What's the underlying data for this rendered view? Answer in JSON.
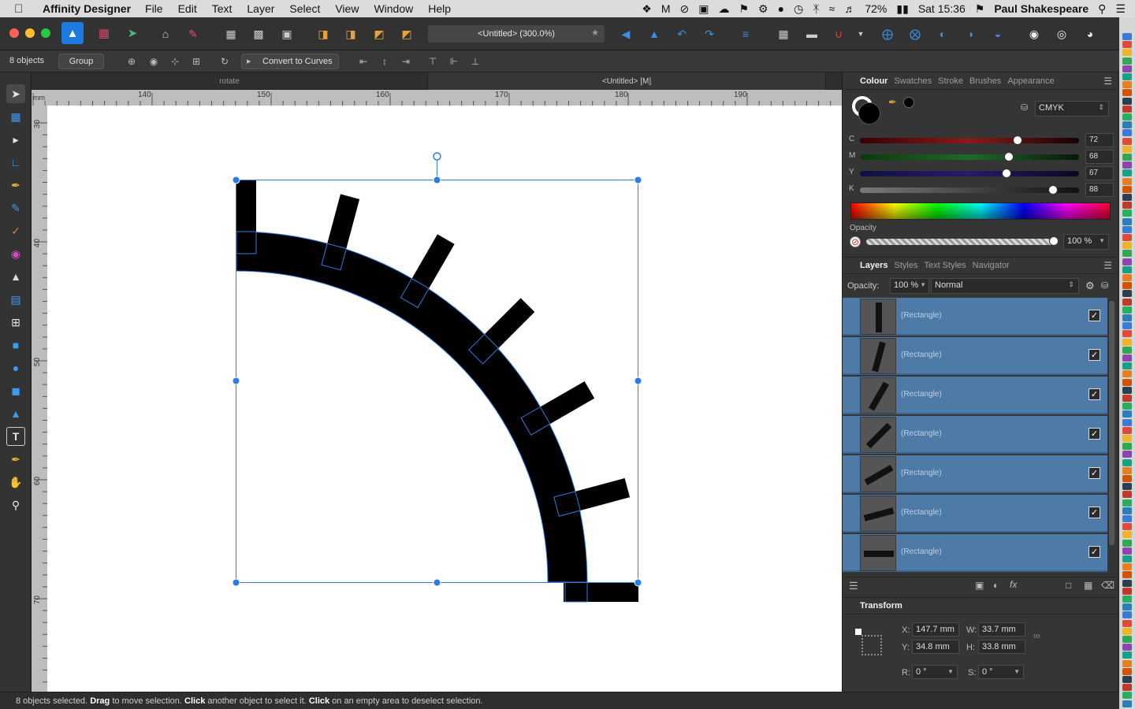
{
  "menubar": {
    "app_name": "Affinity Designer",
    "menus": [
      "File",
      "Edit",
      "Text",
      "Layer",
      "Select",
      "View",
      "Window",
      "Help"
    ],
    "battery": "72%",
    "clock": "Sat 15:36",
    "user": "Paul Shakespeare"
  },
  "toolbar": {
    "document_title": "<Untitled> (300.0%)"
  },
  "context": {
    "selection_count": "8 objects",
    "group_label": "Group",
    "convert_label": "Convert to Curves"
  },
  "doc_tabs": [
    "rotate",
    "<Untitled> [M]"
  ],
  "ruler": {
    "unit": "mm",
    "h_labels": [
      "140",
      "150",
      "160",
      "170",
      "180",
      "190"
    ],
    "v_labels": [
      "30",
      "40",
      "50",
      "60",
      "70"
    ]
  },
  "colour_panel": {
    "tabs": [
      "Colour",
      "Swatches",
      "Stroke",
      "Brushes",
      "Appearance"
    ],
    "model": "CMYK",
    "sliders": [
      {
        "label": "C",
        "value": "72",
        "fraction": 0.72
      },
      {
        "label": "M",
        "value": "68",
        "fraction": 0.68
      },
      {
        "label": "Y",
        "value": "67",
        "fraction": 0.67
      },
      {
        "label": "K",
        "value": "88",
        "fraction": 0.88
      }
    ],
    "opacity_label": "Opacity",
    "opacity_value": "100 %"
  },
  "layers_panel": {
    "tabs": [
      "Layers",
      "Styles",
      "Text Styles",
      "Navigator"
    ],
    "opacity_label": "Opacity:",
    "opacity_value": "100 %",
    "blend_mode": "Normal",
    "layers": [
      {
        "name": "(Rectangle)",
        "rotation": 0
      },
      {
        "name": "(Rectangle)",
        "rotation": 15
      },
      {
        "name": "(Rectangle)",
        "rotation": 30
      },
      {
        "name": "(Rectangle)",
        "rotation": 45
      },
      {
        "name": "(Rectangle)",
        "rotation": 60
      },
      {
        "name": "(Rectangle)",
        "rotation": 75
      },
      {
        "name": "(Rectangle)",
        "rotation": 90
      }
    ]
  },
  "transform_panel": {
    "title": "Transform",
    "x_label": "X:",
    "x": "147.7 mm",
    "y_label": "Y:",
    "y": "34.8 mm",
    "w_label": "W:",
    "w": "33.7 mm",
    "h_label": "H:",
    "h": "33.8 mm",
    "r_label": "R:",
    "r": "0 °",
    "s_label": "S:",
    "s": "0 °"
  },
  "status": {
    "count": "8 objects selected.",
    "drag": "Drag",
    "drag_text": "to move selection.",
    "click1": "Click",
    "click1_text": "another object to select it.",
    "click2": "Click",
    "click2_text": "on an empty area to deselect selection."
  },
  "colors": {
    "accent": "#3a8ee6",
    "selection": "#2f7de1",
    "layer_selected": "#4d7aa7"
  }
}
